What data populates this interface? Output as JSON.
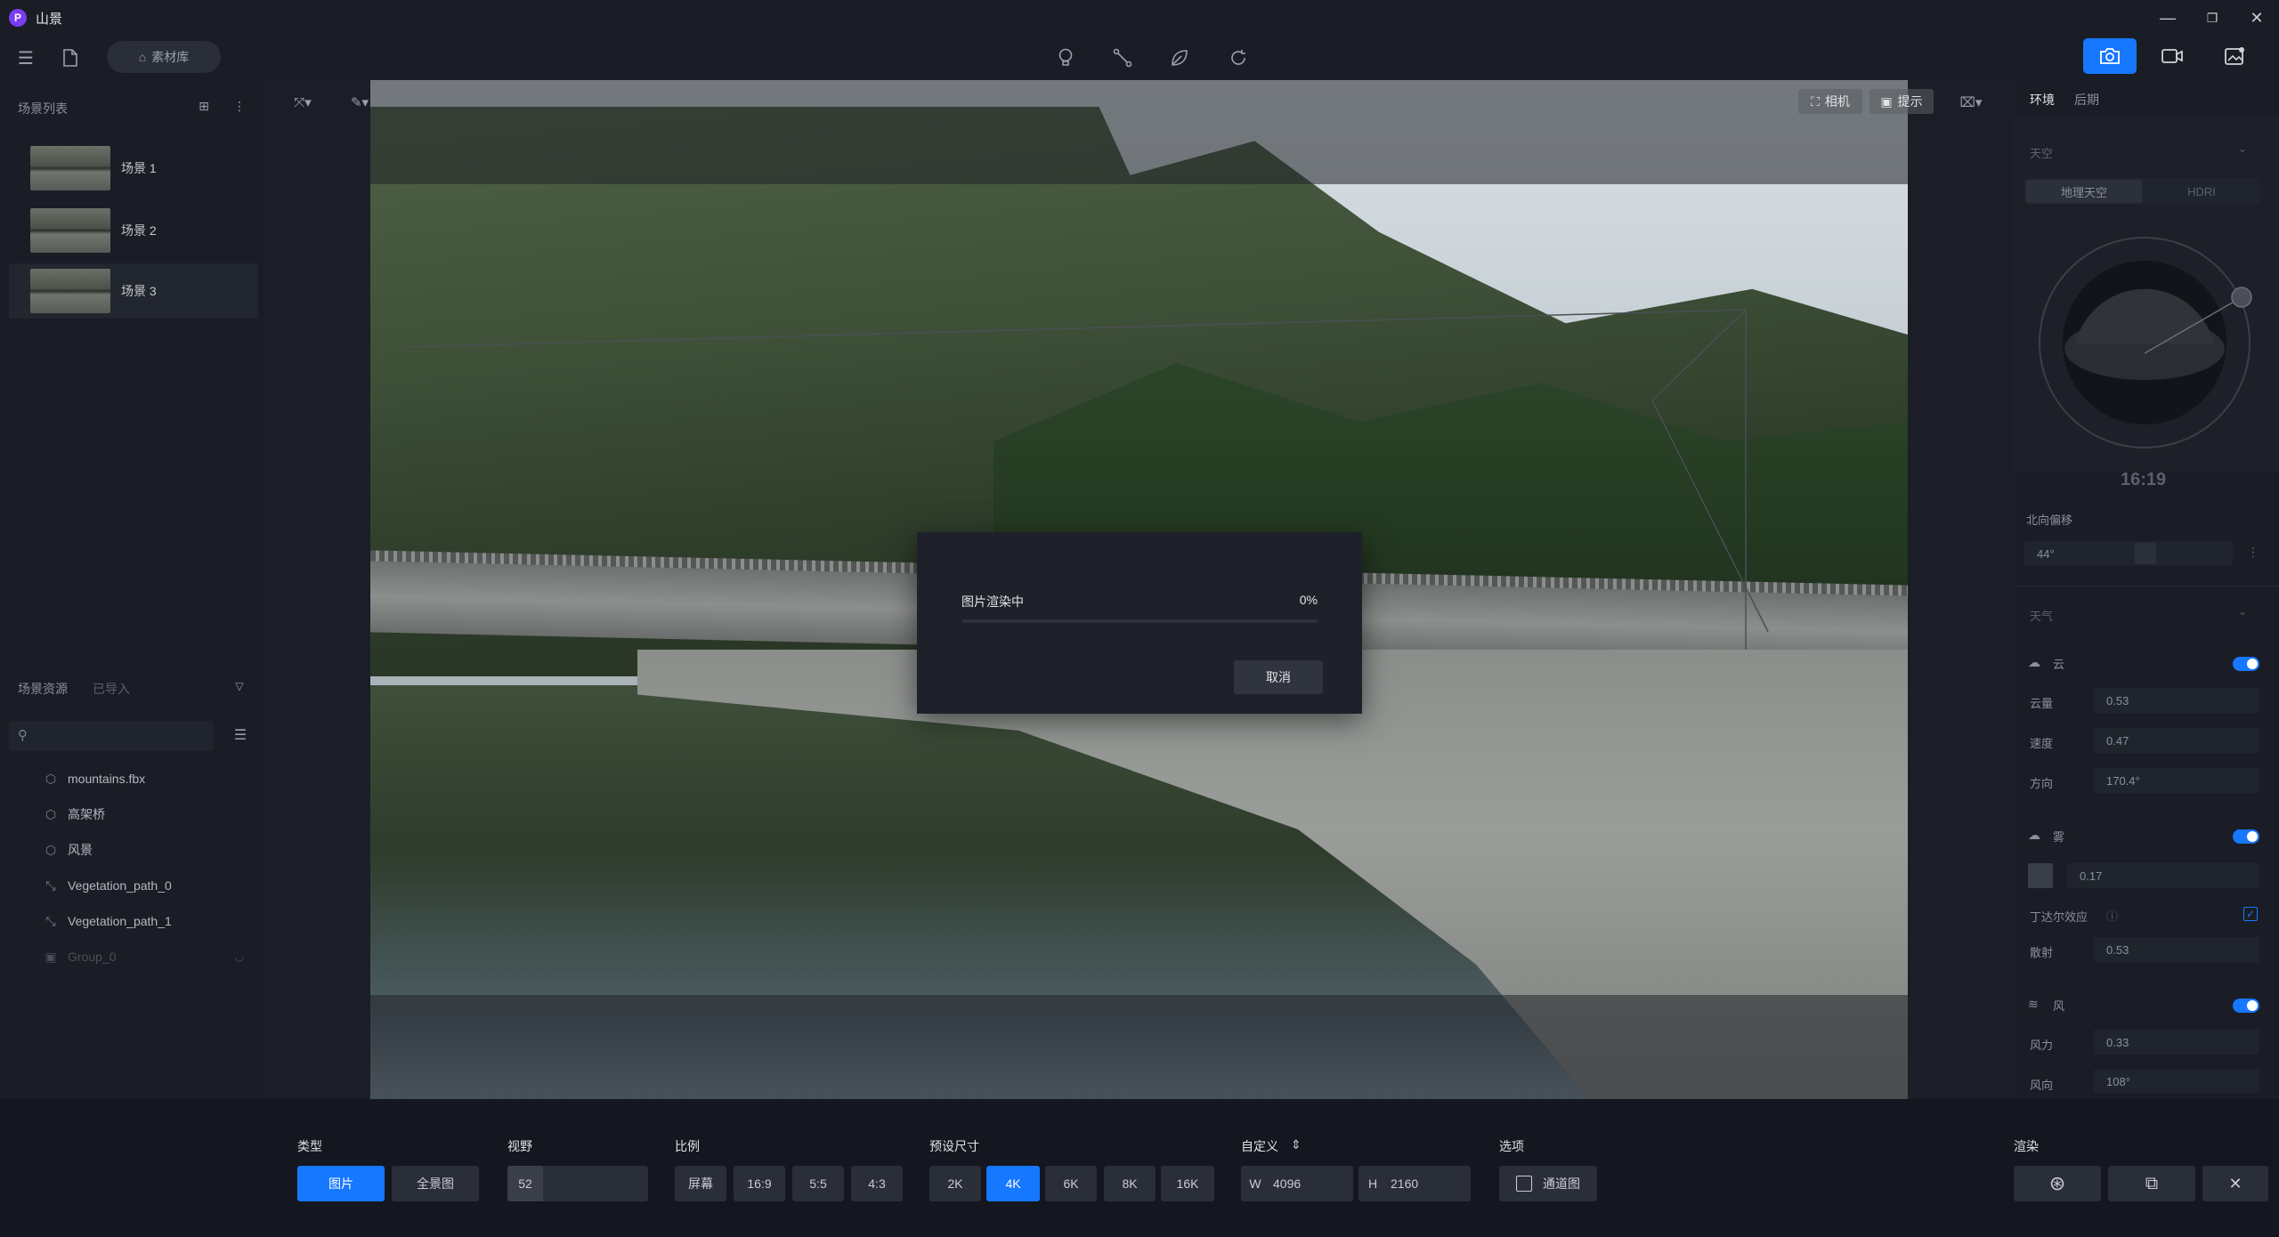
{
  "window": {
    "title": "山景",
    "logo": "P"
  },
  "toolbar": {
    "library_label": "素材库"
  },
  "scene_list": {
    "title": "场景列表",
    "items": [
      {
        "label": "场景 1"
      },
      {
        "label": "场景 2"
      },
      {
        "label": "场景 3"
      }
    ]
  },
  "scene_assets": {
    "title": "场景资源",
    "tab2": "已导入",
    "items": [
      {
        "label": "mountains.fbx",
        "icon": "cube-icon"
      },
      {
        "label": "高架桥",
        "icon": "cube-icon"
      },
      {
        "label": "风景",
        "icon": "cube-icon"
      },
      {
        "label": "Vegetation_path_0",
        "icon": "path-icon"
      },
      {
        "label": "Vegetation_path_1",
        "icon": "path-icon"
      },
      {
        "label": "Group_0",
        "icon": "group-icon"
      }
    ]
  },
  "viewport": {
    "camera_label": "相机",
    "hint_label": "提示"
  },
  "render_dialog": {
    "title": "图片渲染中",
    "percent": "0%",
    "progress": 0,
    "cancel_label": "取消"
  },
  "right_panel": {
    "tabs": [
      "环境",
      "后期"
    ],
    "sky_section": "天空",
    "sky_tabs": [
      "地理天空",
      "HDRI"
    ],
    "time": "16:19",
    "north_offset_label": "北向偏移",
    "north_offset_value": "44°",
    "weather_section": "天气",
    "cloud": {
      "label": "云",
      "amount_label": "云量",
      "amount": "0.53",
      "speed_label": "速度",
      "speed": "0.47",
      "direction_label": "方向",
      "direction": "170.4°"
    },
    "fog": {
      "label": "雾",
      "value": "0.17",
      "tyndall_label": "丁达尔效应",
      "scatter_label": "散射",
      "scatter": "0.53"
    },
    "wind": {
      "label": "风",
      "force_label": "风力",
      "force": "0.33",
      "direction_label": "风向",
      "direction": "108°"
    }
  },
  "bottom": {
    "type_label": "类型",
    "type_options": [
      "图片",
      "全景图"
    ],
    "fov_label": "视野",
    "fov_value": "52",
    "ratio_label": "比例",
    "ratio_options": [
      "屏幕",
      "16:9",
      "5:5",
      "4:3"
    ],
    "preset_label": "预设尺寸",
    "preset_options": [
      "2K",
      "4K",
      "6K",
      "8K",
      "16K"
    ],
    "custom_label": "自定义",
    "w_label": "W",
    "w_value": "4096",
    "h_label": "H",
    "h_value": "2160",
    "options_label": "选项",
    "channel_label": "通道图",
    "render_label": "渲染"
  },
  "colors": {
    "accent": "#1677ff",
    "panel": "#1a1d25",
    "background": "#14171f"
  }
}
